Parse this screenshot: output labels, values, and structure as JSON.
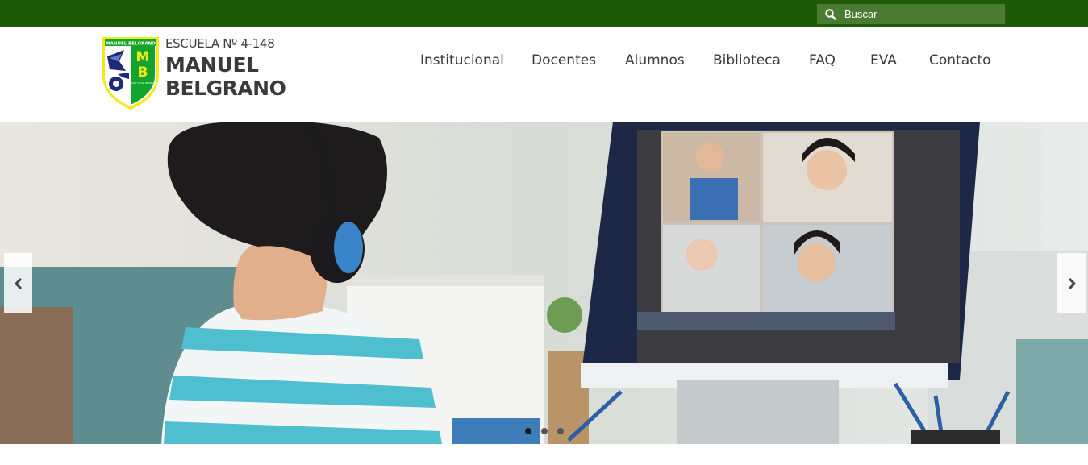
{
  "search": {
    "placeholder": "Buscar",
    "icon": "search-icon"
  },
  "logo": {
    "crest_text_top": "MANUEL BELGRANO",
    "crest_initials_m": "M",
    "crest_initials_b": "B",
    "crest_text_small": "GODOY CRUZ MENDOZA",
    "subtitle": "ESCUELA Nº 4-148",
    "name_line1": "MANUEL",
    "name_line2": "BELGRANO",
    "colors": {
      "green": "#13a52b",
      "yellow": "#f4e81d",
      "navy": "#1d2a7a"
    }
  },
  "nav": {
    "items": [
      {
        "label": "Institucional"
      },
      {
        "label": "Docentes"
      },
      {
        "label": "Alumnos"
      },
      {
        "label": "Biblioteca"
      },
      {
        "label": "FAQ"
      },
      {
        "label": "EVA"
      },
      {
        "label": "Contacto"
      }
    ]
  },
  "slider": {
    "prev_icon": "chevron-left-icon",
    "next_icon": "chevron-right-icon",
    "slide_count": 3,
    "active_slide": 1
  },
  "colors": {
    "topbar": "#1f5a06",
    "search_bg": "#4a7b32",
    "nav_text": "#3a3a3a"
  }
}
